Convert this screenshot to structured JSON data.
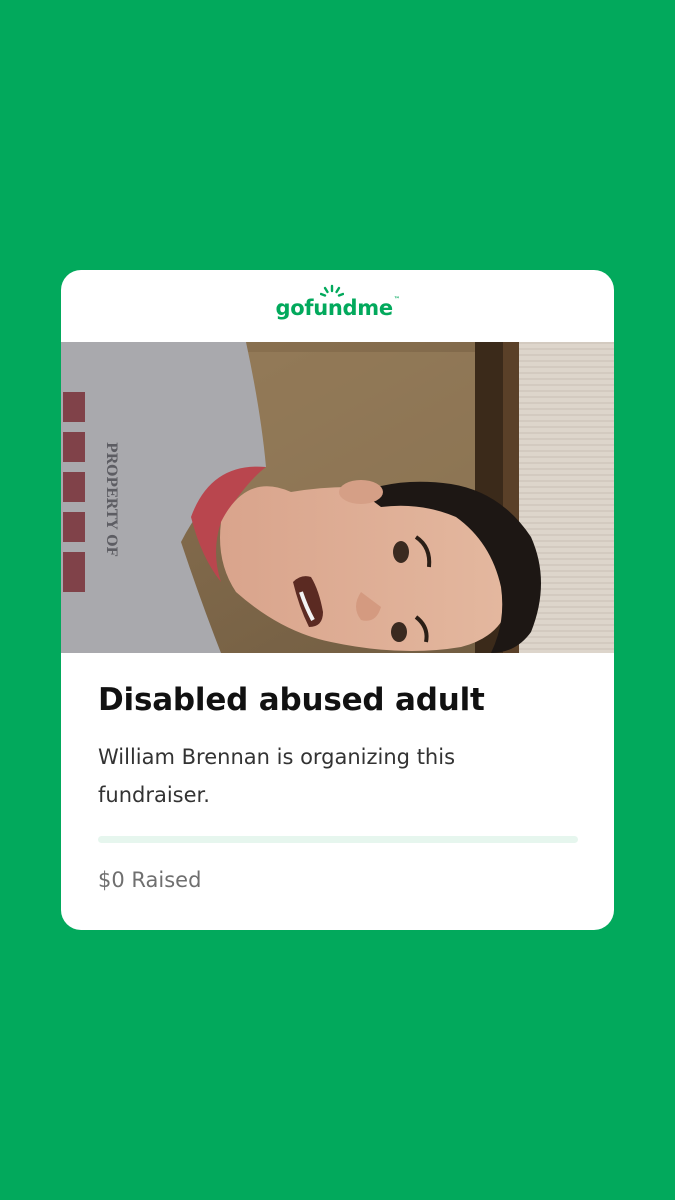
{
  "brand": {
    "name": "gofundme",
    "trademark": "™",
    "accent_color": "#02A95C",
    "background_color": "#02A95C"
  },
  "fundraiser": {
    "title": "Disabled abused adult",
    "organizer_text": "William Brennan is organizing this fundraiser.",
    "raised_text": "$0 Raised",
    "progress_fraction": 0
  },
  "photo": {
    "shirt_text": "PROPERTY OF"
  }
}
